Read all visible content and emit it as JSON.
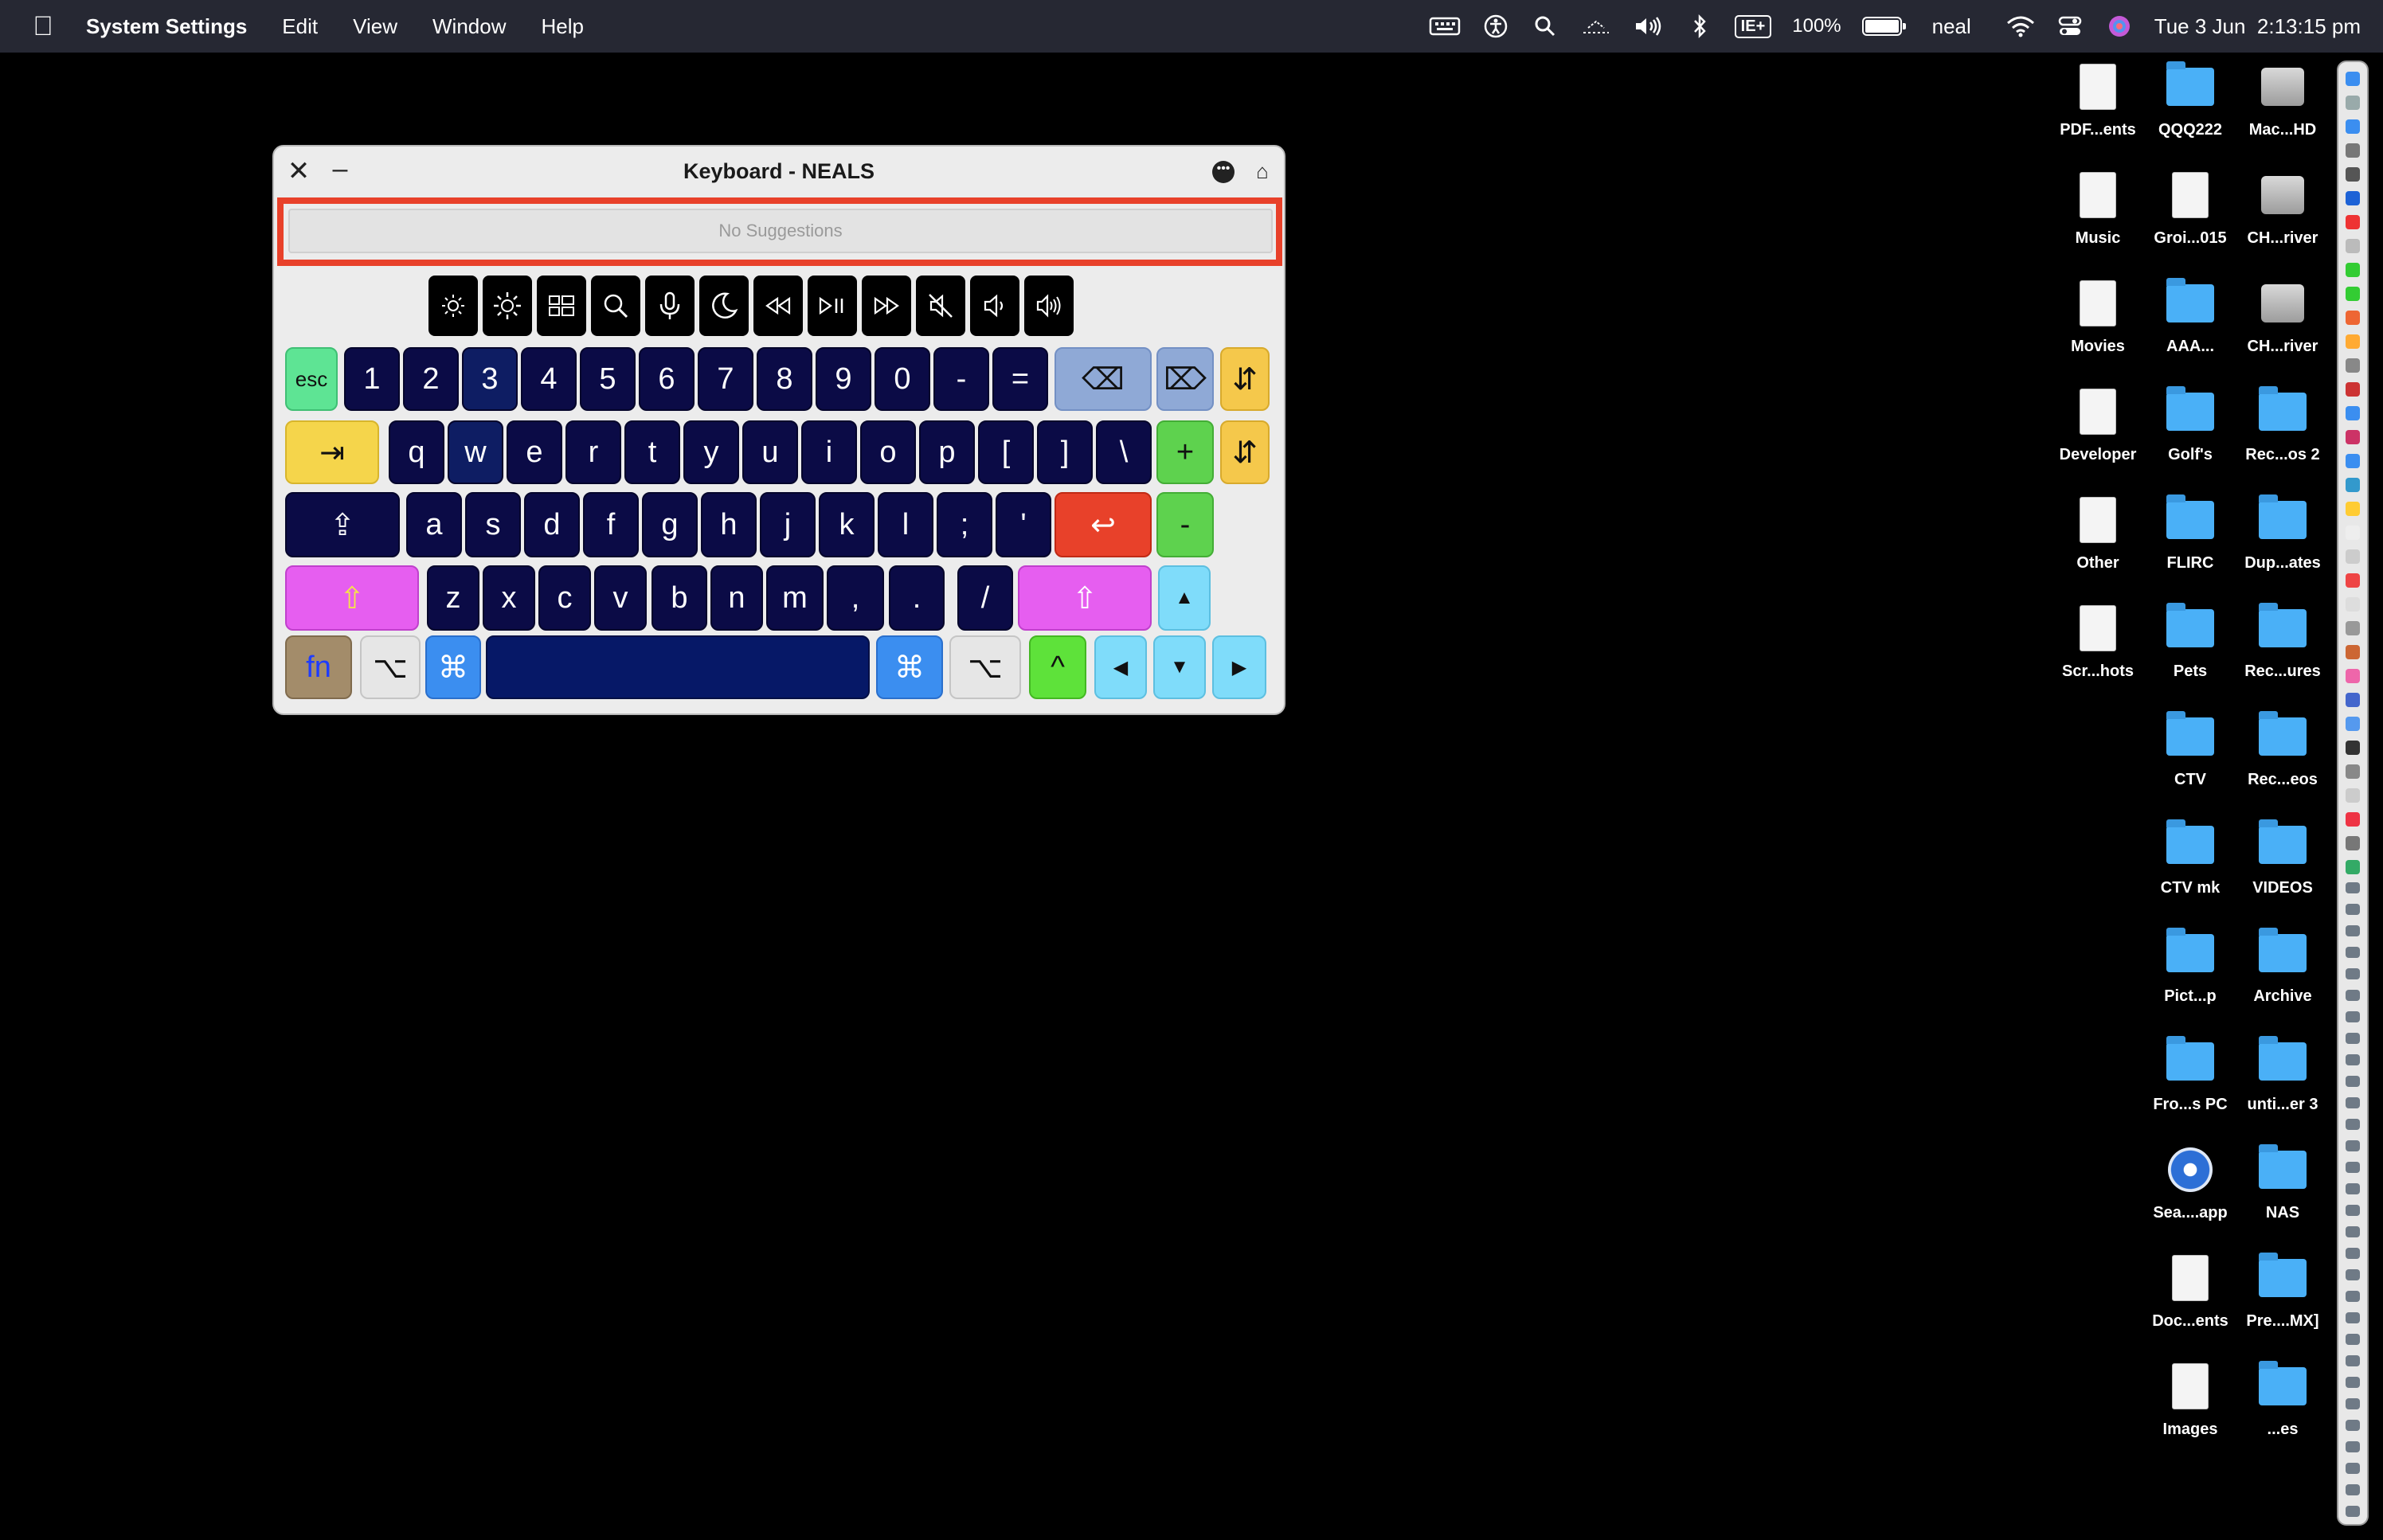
{
  "menubar": {
    "app_name": "System Settings",
    "menus": [
      "Edit",
      "View",
      "Window",
      "Help"
    ],
    "battery": "100%",
    "user": "neal",
    "datetime": "Tue 3 Jun  2:13:15 pm",
    "input_source": "IE+"
  },
  "keyboard_window": {
    "title": "Keyboard - NEALS",
    "suggestions_placeholder": "No Suggestions",
    "highlight_color": "#e8412a",
    "function_keys": [
      "brightness-down-icon",
      "brightness-up-icon",
      "mission-control-icon",
      "search-icon",
      "microphone-icon",
      "moon-icon",
      "rewind-icon",
      "play-pause-icon",
      "fast-forward-icon",
      "mute-icon",
      "volume-down-icon",
      "volume-up-icon"
    ],
    "row1": [
      "esc",
      "1",
      "2",
      "3",
      "4",
      "5",
      "6",
      "7",
      "8",
      "9",
      "0",
      "-",
      "="
    ],
    "row2": [
      "q",
      "w",
      "e",
      "r",
      "t",
      "y",
      "u",
      "i",
      "o",
      "p",
      "[",
      "]",
      "\\"
    ],
    "row3": [
      "a",
      "s",
      "d",
      "f",
      "g",
      "h",
      "j",
      "k",
      "l",
      ";",
      "'"
    ],
    "row4": [
      "z",
      "x",
      "c",
      "v",
      "b",
      "n",
      "m",
      ",",
      ".",
      "/"
    ],
    "modifiers": {
      "fn": "fn",
      "option": "⌥",
      "command": "⌘",
      "tab": "⇥",
      "caps": "⇪",
      "shift": "⇧",
      "return": "↩",
      "delete": "⌫",
      "forward_delete": "⌦",
      "plus": "+",
      "minus": "-",
      "up": "▲",
      "down": "▼",
      "left": "◀",
      "right": "▶",
      "ctrl": "^"
    }
  },
  "desktop_icons": [
    {
      "label": "PDF...ents"
    },
    {
      "label": "QQQ222"
    },
    {
      "label": "Mac...HD"
    },
    {
      "label": "Music"
    },
    {
      "label": "Groi...015"
    },
    {
      "label": "CH...river"
    },
    {
      "label": "Movies"
    },
    {
      "label": "AAA..."
    },
    {
      "label": "CH...river"
    },
    {
      "label": "Developer"
    },
    {
      "label": "Golf's"
    },
    {
      "label": "Rec...os 2"
    },
    {
      "label": "Other"
    },
    {
      "label": "FLIRC"
    },
    {
      "label": "Dup...ates"
    },
    {
      "label": "Scr...hots"
    },
    {
      "label": "Pets"
    },
    {
      "label": "Rec...ures"
    },
    {
      "label": ""
    },
    {
      "label": "CTV"
    },
    {
      "label": "Rec...eos"
    },
    {
      "label": ""
    },
    {
      "label": "CTV mk"
    },
    {
      "label": "VIDEOS"
    },
    {
      "label": ""
    },
    {
      "label": "Pict...p"
    },
    {
      "label": "Archive"
    },
    {
      "label": ""
    },
    {
      "label": "Fro...s PC"
    },
    {
      "label": "unti...er 3"
    },
    {
      "label": ""
    },
    {
      "label": "Sea....app"
    },
    {
      "label": "NAS"
    },
    {
      "label": ""
    },
    {
      "label": "Doc...ents"
    },
    {
      "label": "Pre....MX]"
    },
    {
      "label": ""
    },
    {
      "label": "Images"
    },
    {
      "label": "...es"
    }
  ]
}
